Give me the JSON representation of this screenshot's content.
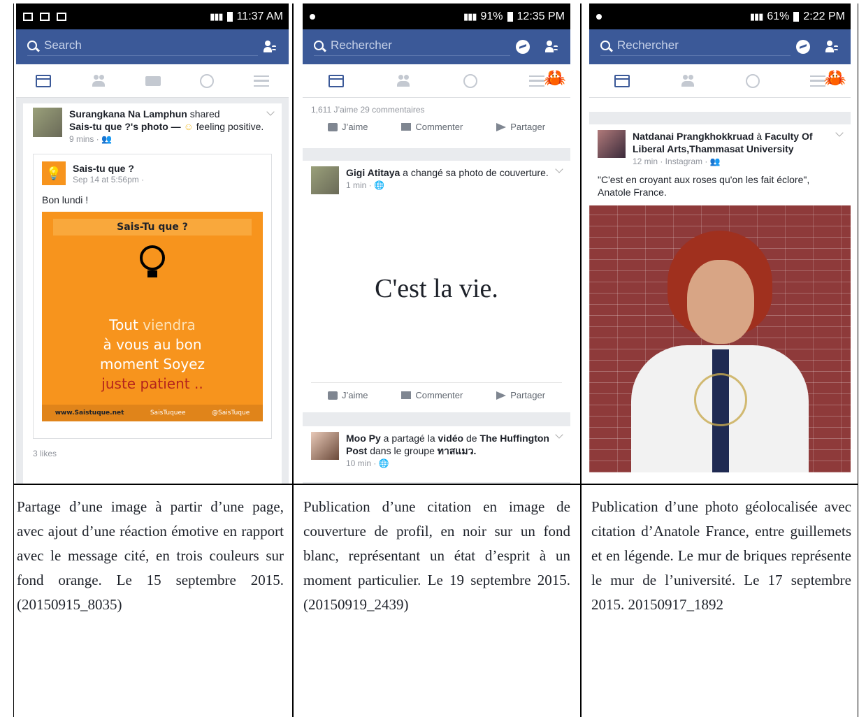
{
  "columns": [
    {
      "status": {
        "time": "11:37 AM"
      },
      "search_placeholder": "Search",
      "post": {
        "author": "Surangkana Na Lamphun",
        "shared_text": "shared",
        "page_ref": "Sais-tu que ?",
        "photo_text": "'s photo —",
        "feeling": "feeling positive.",
        "time": "9 mins ·",
        "inner_author": "Sais-tu que ?",
        "inner_time": "Sep 14 at 5:56pm ·",
        "message": "Bon lundi !",
        "image": {
          "header": "Sais-Tu que ?",
          "line1a": "Tout",
          "line1b": "viendra",
          "line2": "à vous au bon",
          "line3": "moment Soyez",
          "line4": "juste patient ..",
          "footer_site": "www.Saistuque.net",
          "footer_fb": "SaisTuquee",
          "footer_tw": "@SaisTuque"
        },
        "likes": "3 likes"
      },
      "caption": "Partage d’une image à partir d’une page, avec ajout d’une réaction émotive en rapport avec le message cité, en trois couleurs sur fond orange. Le 15 septembre 2015. (20150915_8035)"
    },
    {
      "status": {
        "battery": "91%",
        "time": "12:35 PM"
      },
      "search_placeholder": "Rechercher",
      "counts": "1,611 J’aime  29 commentaires",
      "actions": {
        "like": "J’aime",
        "comment": "Commenter",
        "share": "Partager"
      },
      "post": {
        "author": "Gigi Atitaya",
        "story": "a changé sa photo de couverture.",
        "time": "1 min ·",
        "quote": "C'est la vie."
      },
      "post2": {
        "author": "Moo Py",
        "story_a": "a partagé la",
        "video": "vidéo",
        "story_b": "de",
        "page": "The Huffington Post",
        "story_c": "dans le groupe",
        "group": "ทาสแมว.",
        "time": "10 min ·"
      },
      "caption": "Publication d’une citation en image de couverture de profil, en noir sur un fond blanc, représentant un état d’esprit à un moment particulier. Le 19 septembre 2015. (20150919_2439)"
    },
    {
      "status": {
        "battery": "61%",
        "time": "2:22 PM"
      },
      "search_placeholder": "Rechercher",
      "post": {
        "author": "Natdanai Prangkhokkruad",
        "at": "à",
        "place": "Faculty Of Liberal Arts,Thammasat University",
        "time": "12 min · Instagram ·",
        "quote": "\"C'est en croyant aux roses qu'on les fait éclore\", Anatole France."
      },
      "caption": "Publication d’une photo géolocalisée avec citation d’Anatole France, entre guillemets et en légende. Le mur de briques représente le mur de l’université. Le 17 septembre 2015. 20150917_1892"
    }
  ]
}
